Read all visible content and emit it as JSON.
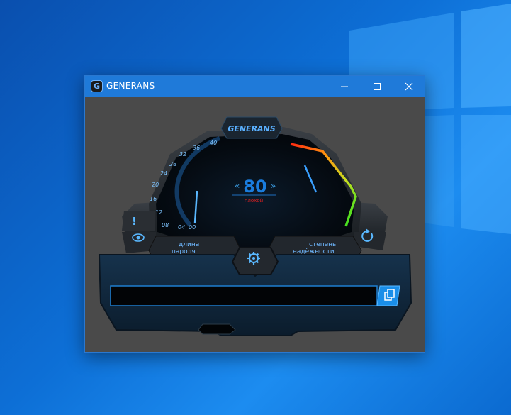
{
  "window": {
    "title": "GENERANS",
    "minimize_icon": "minimize-icon",
    "maximize_icon": "maximize-icon",
    "close_icon": "close-icon"
  },
  "app": {
    "brand_label": "GENERANS",
    "length_display": "80",
    "strength_text": "плохой",
    "scale_ticks": [
      "00",
      "04",
      "08",
      "12",
      "16",
      "20",
      "24",
      "28",
      "32",
      "36",
      "40"
    ],
    "length_label_line1": "длина",
    "length_label_line2": "пароля",
    "strength_label_line1": "степень",
    "strength_label_line2": "надёжности",
    "password_value": "",
    "icons": {
      "warning": "exclamation-icon",
      "show_password": "eye-icon",
      "refresh": "refresh-icon",
      "settings": "gear-icon",
      "copy": "copy-icon"
    },
    "colors": {
      "accent": "#1e9bff",
      "strength_text": "#e02020",
      "panel": "#0f2336"
    }
  }
}
